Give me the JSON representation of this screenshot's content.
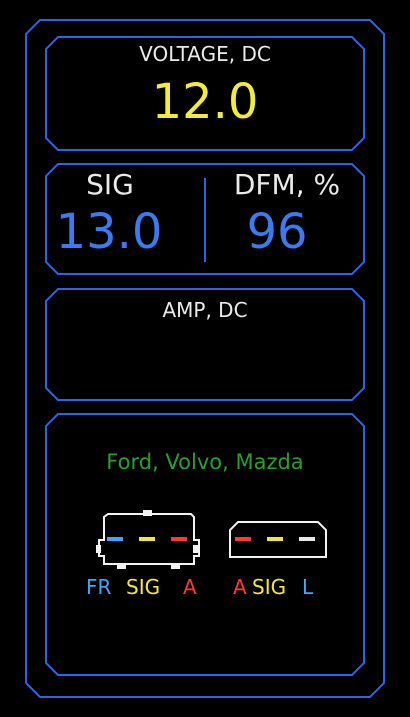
{
  "voltage": {
    "title": "VOLTAGE, DC",
    "value": "12.0"
  },
  "sig": {
    "label": "SIG",
    "value": "13.0"
  },
  "dfm": {
    "label": "DFM, %",
    "value": "96"
  },
  "amp": {
    "title": "AMP, DC",
    "value": ""
  },
  "connector": {
    "brands": "Ford, Volvo, Mazda",
    "left_pins": [
      "FR",
      "SIG",
      "A"
    ],
    "right_pins": [
      "A",
      "SIG",
      "L"
    ],
    "left_colors": [
      "#3ea6ff",
      "#f4e93a",
      "#ff3b2f"
    ],
    "right_colors": [
      "#ff3b2f",
      "#f4e93a",
      "#e8e8e8"
    ]
  },
  "colors": {
    "frame": "#2d63e6",
    "value_yellow": "#f3ec3a",
    "value_blue": "#3b7bf0",
    "brand_green": "#27a02c"
  }
}
